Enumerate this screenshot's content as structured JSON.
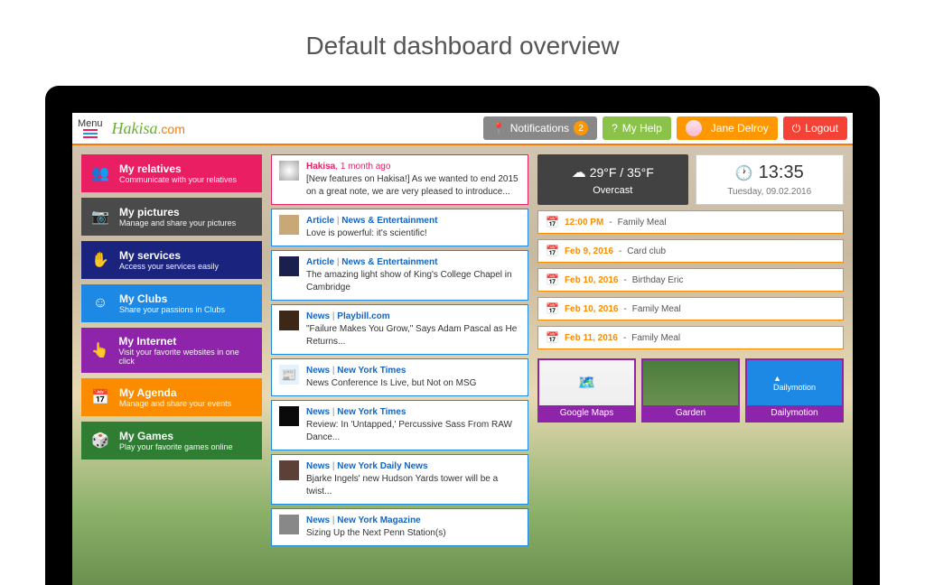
{
  "page_title": "Default dashboard overview",
  "topbar": {
    "menu_label": "Menu",
    "logo_main": "Hakisa",
    "logo_suffix": ".com",
    "notifications_label": "Notifications",
    "notifications_count": "2",
    "help_label": "My Help",
    "user_name": "Jane Delroy",
    "logout_label": "Logout"
  },
  "nav": [
    {
      "title": "My relatives",
      "sub": "Communicate with your relatives"
    },
    {
      "title": "My pictures",
      "sub": "Manage and share your pictures"
    },
    {
      "title": "My services",
      "sub": "Access your services easily"
    },
    {
      "title": "My Clubs",
      "sub": "Share your passions in Clubs"
    },
    {
      "title": "My Internet",
      "sub": "Visit your favorite websites in one click"
    },
    {
      "title": "My Agenda",
      "sub": "Manage and share your events"
    },
    {
      "title": "My Games",
      "sub": "Play your favorite games online"
    }
  ],
  "feed": [
    {
      "source": "Hakisa",
      "time": "1 month ago",
      "body": "[New features on Hakisa!] As we wanted to end 2015 on a great note, we are very pleased to introduce..."
    },
    {
      "cat1": "Article",
      "cat2": "News & Entertainment",
      "body": "Love is powerful: it's scientific!"
    },
    {
      "cat1": "Article",
      "cat2": "News & Entertainment",
      "body": "The amazing light show of King's College Chapel in Cambridge"
    },
    {
      "cat1": "News",
      "cat2": "Playbill.com",
      "body": "\"Failure Makes You Grow,\" Says Adam Pascal as He Returns..."
    },
    {
      "cat1": "News",
      "cat2": "New York Times",
      "body": "News Conference Is Live, but Not on MSG"
    },
    {
      "cat1": "News",
      "cat2": "New York Times",
      "body": "Review: In 'Untapped,' Percussive Sass From RAW Dance..."
    },
    {
      "cat1": "News",
      "cat2": "New York Daily News",
      "body": "Bjarke Ingels' new Hudson Yards tower will be a twist..."
    },
    {
      "cat1": "News",
      "cat2": "New York Magazine",
      "body": "Sizing Up the Next Penn Station(s)"
    }
  ],
  "weather": {
    "temp": "29°F / 35°F",
    "cond": "Overcast"
  },
  "clock": {
    "time": "13:35",
    "date": "Tuesday, 09.02.2016"
  },
  "agenda": [
    {
      "date": "12:00 PM",
      "text": "Family Meal"
    },
    {
      "date": "Feb 9, 2016",
      "text": "Card club"
    },
    {
      "date": "Feb 10, 2016",
      "text": "Birthday Eric"
    },
    {
      "date": "Feb 10, 2016",
      "text": "Family Meal"
    },
    {
      "date": "Feb 11, 2016",
      "text": "Family Meal"
    }
  ],
  "shortcuts": [
    {
      "label": "Google Maps"
    },
    {
      "label": "Garden"
    },
    {
      "label": "Dailymotion"
    }
  ]
}
